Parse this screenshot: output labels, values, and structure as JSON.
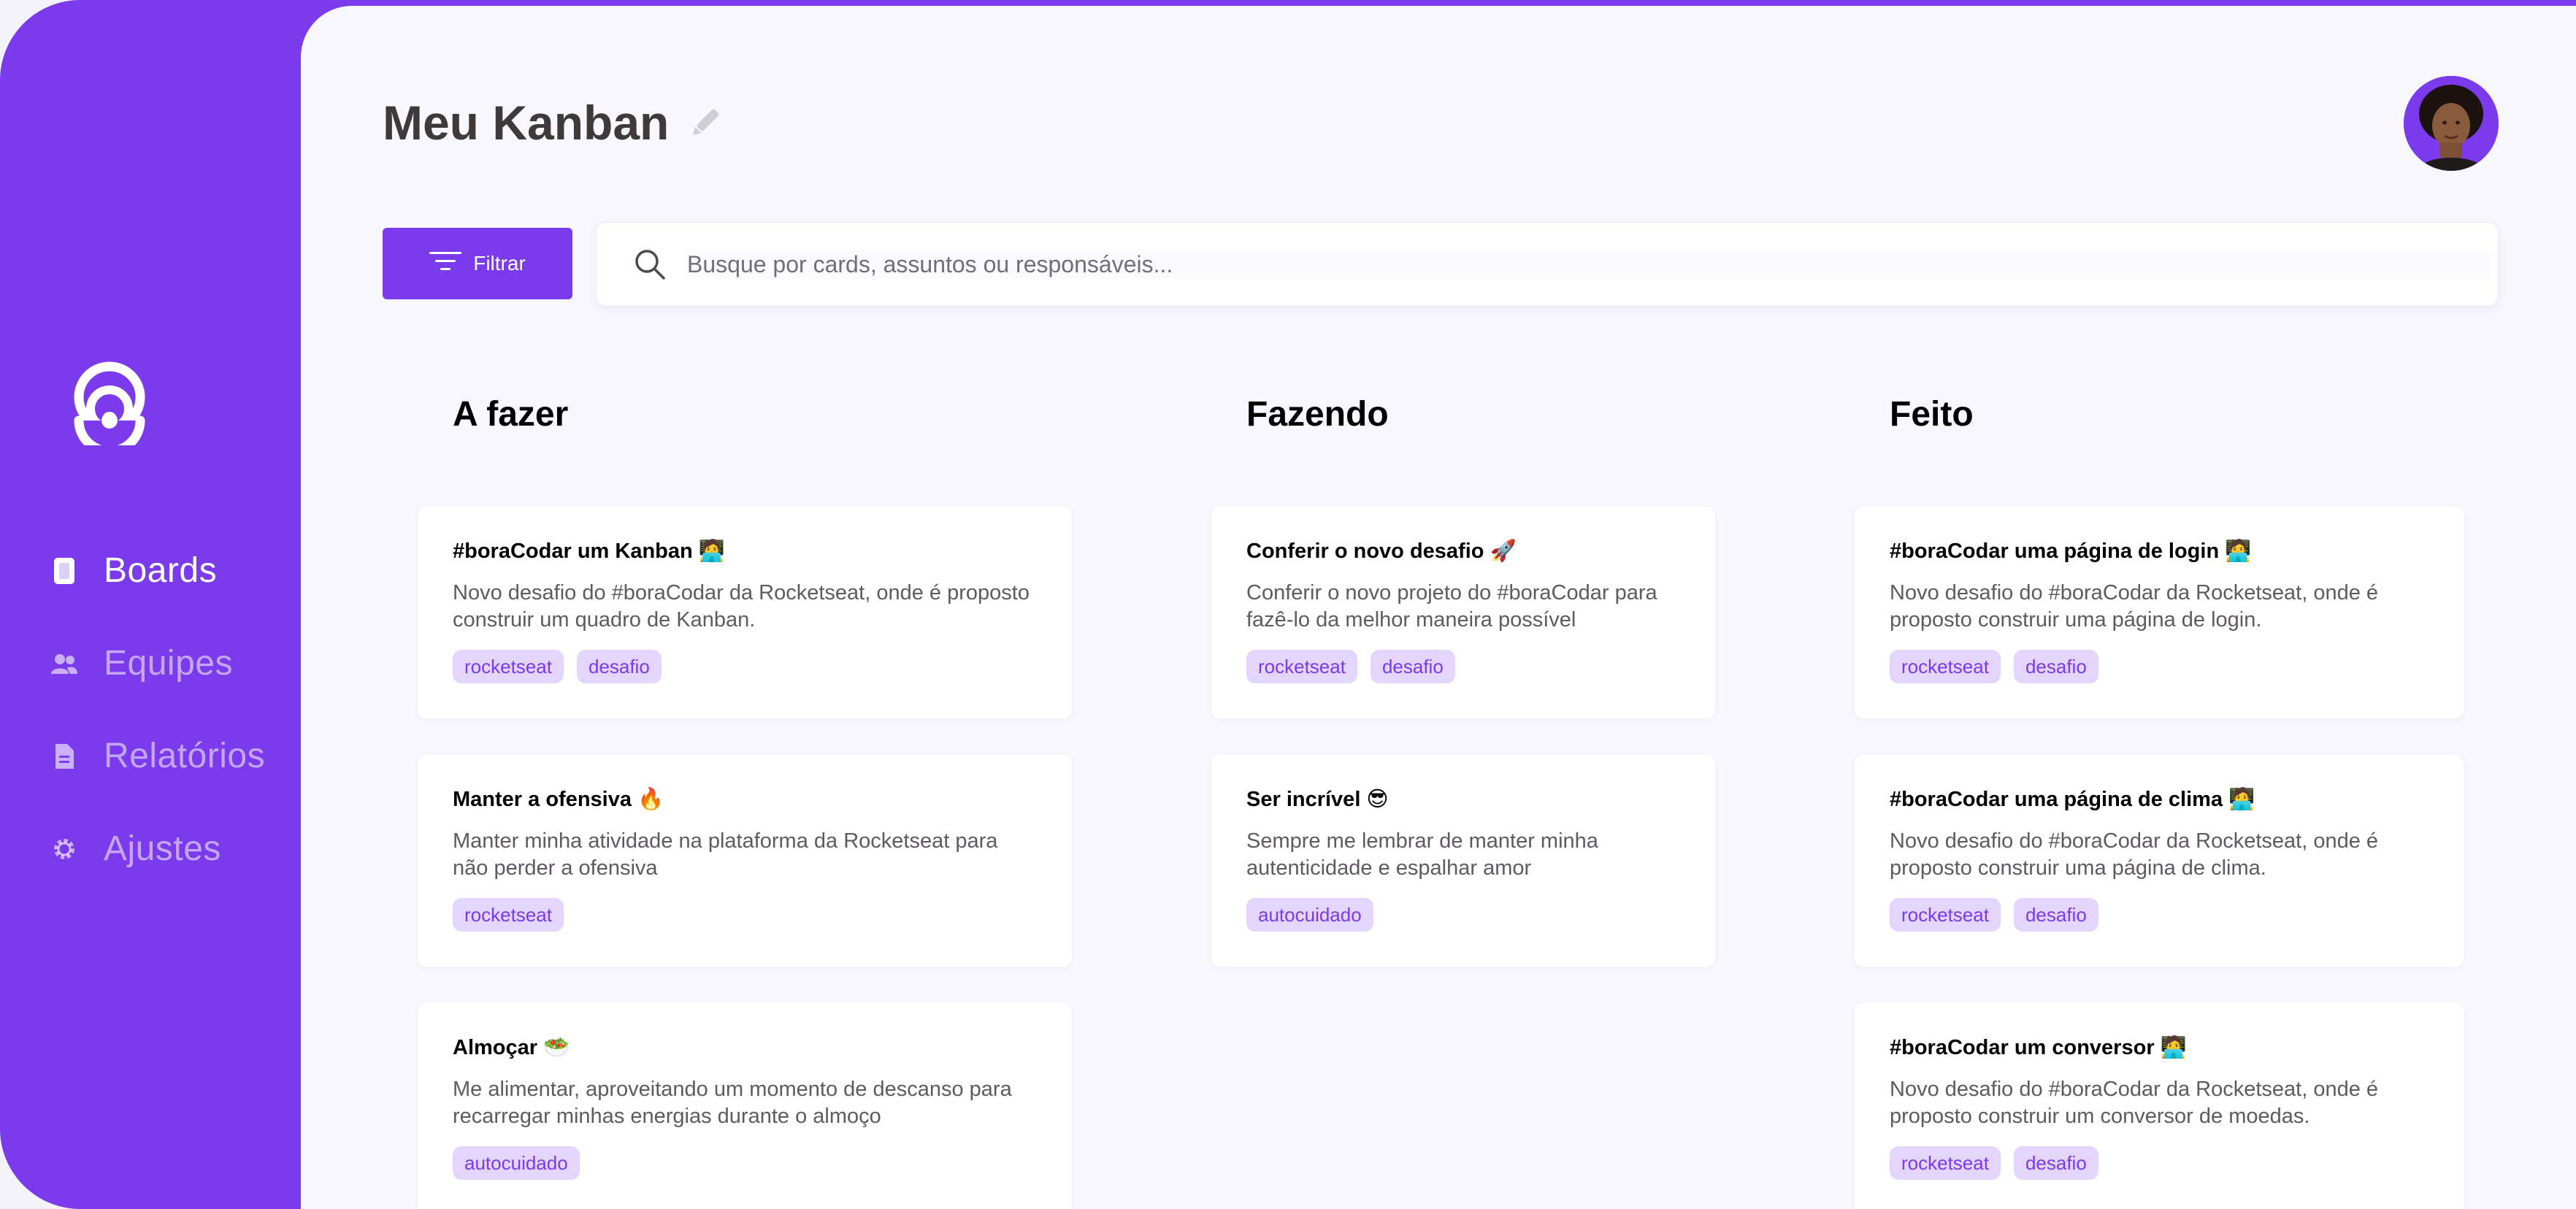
{
  "sidebar": {
    "logo": "rocketseat-logo",
    "items": [
      {
        "label": "Boards",
        "icon": "board-icon",
        "active": true
      },
      {
        "label": "Equipes",
        "icon": "team-icon",
        "active": false
      },
      {
        "label": "Relatórios",
        "icon": "report-icon",
        "active": false
      },
      {
        "label": "Ajustes",
        "icon": "gear-icon",
        "active": false
      }
    ]
  },
  "header": {
    "title": "Meu Kanban",
    "edit_icon": "pencil-icon",
    "avatar": "user-avatar"
  },
  "toolbar": {
    "filter_label": "Filtrar",
    "filter_icon": "filter-icon",
    "search_placeholder": "Busque por cards, assuntos ou responsáveis...",
    "search_icon": "search-icon"
  },
  "columns": [
    {
      "title": "A fazer",
      "cards": [
        {
          "title": "#boraCodar um Kanban 🧑‍💻",
          "desc": "Novo desafio do #boraCodar da Rocketseat, onde é proposto construir um quadro de Kanban.",
          "tags": [
            "rocketseat",
            "desafio"
          ]
        },
        {
          "title": "Manter a ofensiva 🔥",
          "desc": "Manter minha atividade na plataforma da Rocketseat para não perder a ofensiva",
          "tags": [
            "rocketseat"
          ]
        },
        {
          "title": "Almoçar 🥗",
          "desc": "Me alimentar, aproveitando um momento de descanso para recarregar minhas energias durante o almoço",
          "tags": [
            "autocuidado"
          ]
        }
      ]
    },
    {
      "title": "Fazendo",
      "cards": [
        {
          "title": "Conferir o novo desafio 🚀",
          "desc": "Conferir o novo projeto do #boraCodar para fazê-lo da melhor maneira possível",
          "tags": [
            "rocketseat",
            "desafio"
          ]
        },
        {
          "title": "Ser incrível 😎",
          "desc": "Sempre me lembrar de manter minha autenticidade e espalhar amor",
          "tags": [
            "autocuidado"
          ]
        }
      ]
    },
    {
      "title": "Feito",
      "cards": [
        {
          "title": "#boraCodar uma página de login 🧑‍💻",
          "desc": "Novo desafio do #boraCodar da Rocketseat, onde é proposto construir uma página de login.",
          "tags": [
            "rocketseat",
            "desafio"
          ]
        },
        {
          "title": "#boraCodar uma página de clima 🧑‍💻",
          "desc": "Novo desafio do #boraCodar da Rocketseat, onde é proposto construir uma página de clima.",
          "tags": [
            "rocketseat",
            "desafio"
          ]
        },
        {
          "title": "#boraCodar um conversor 🧑‍💻",
          "desc": "Novo desafio do #boraCodar da Rocketseat, onde é proposto construir um conversor de moedas.",
          "tags": [
            "rocketseat",
            "desafio"
          ]
        }
      ]
    }
  ],
  "colors": {
    "accent": "#7c3aed",
    "tag_bg": "#e3d5fd",
    "main_bg": "#f8f7fd"
  }
}
